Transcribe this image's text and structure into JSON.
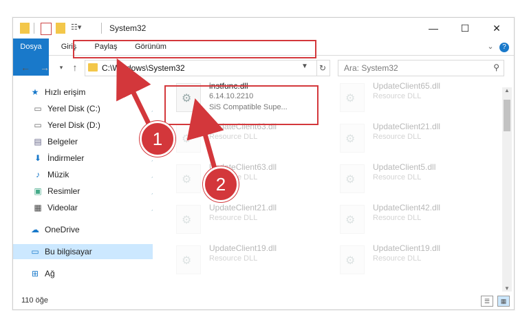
{
  "window": {
    "title": "System32",
    "controls": {
      "minimize": "—",
      "maximize": "☐",
      "close": "✕"
    }
  },
  "ribbon": {
    "tabs": [
      "Dosya",
      "Giriş",
      "Paylaş",
      "Görünüm"
    ]
  },
  "address": {
    "path": "C:\\Windows\\System32",
    "search_placeholder": "Ara: System32"
  },
  "nav": {
    "items": [
      {
        "label": "Hızlı erişim",
        "icon": "star-icon",
        "pinned": false
      },
      {
        "label": "Yerel Disk (C:)",
        "icon": "drive-icon",
        "pinned": true
      },
      {
        "label": "Yerel Disk (D:)",
        "icon": "drive-icon",
        "pinned": true
      },
      {
        "label": "Belgeler",
        "icon": "document-icon",
        "pinned": true
      },
      {
        "label": "İndirmeler",
        "icon": "download-icon",
        "pinned": true
      },
      {
        "label": "Müzik",
        "icon": "music-icon",
        "pinned": true
      },
      {
        "label": "Resimler",
        "icon": "pictures-icon",
        "pinned": true
      },
      {
        "label": "Videolar",
        "icon": "video-icon",
        "pinned": true
      },
      {
        "label": "OneDrive",
        "icon": "cloud-icon",
        "pinned": false
      },
      {
        "label": "Bu bilgisayar",
        "icon": "computer-icon",
        "pinned": false,
        "selected": true
      },
      {
        "label": "Ağ",
        "icon": "network-icon",
        "pinned": false
      }
    ]
  },
  "files": {
    "highlighted": {
      "name": "instfunc.dll",
      "version": "6.14.10.2210",
      "description": "SiS Compatible Supe..."
    },
    "left_column": [
      {
        "name": "UpdateClient63.dll",
        "description": "Resource DLL"
      },
      {
        "name": "UpdateClient63.dll",
        "description": "Resource DLL"
      },
      {
        "name": "UpdateClient21.dll",
        "description": "Resource DLL"
      },
      {
        "name": "UpdateClient19.dll",
        "description": "Resource DLL"
      }
    ],
    "right_column": [
      {
        "name": "UpdateClient65.dll",
        "description": "Resource DLL"
      },
      {
        "name": "UpdateClient21.dll",
        "description": "Resource DLL"
      },
      {
        "name": "UpdateClient5.dll",
        "description": "Resource DLL"
      },
      {
        "name": "UpdateClient42.dll",
        "description": "Resource DLL"
      },
      {
        "name": "UpdateClient19.dll",
        "description": "Resource DLL"
      }
    ]
  },
  "status": {
    "count": "110 öğe"
  },
  "annotations": {
    "badge1": "1",
    "badge2": "2",
    "accent_color": "#d3373b"
  }
}
